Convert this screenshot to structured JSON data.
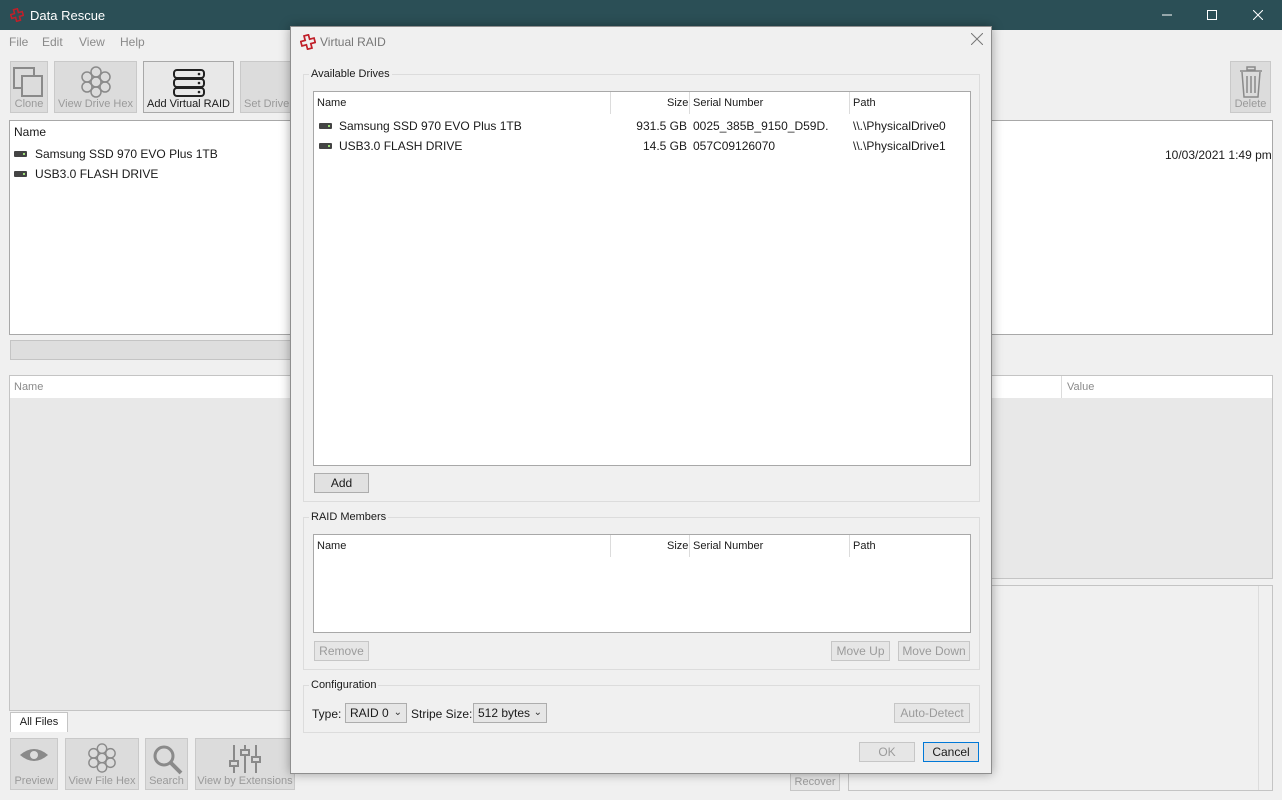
{
  "app": {
    "title": "Data Rescue"
  },
  "menu": {
    "file": "File",
    "edit": "Edit",
    "view": "View",
    "help": "Help"
  },
  "toolbar": {
    "clone": "Clone",
    "view_drive_hex": "View Drive Hex",
    "add_virtual_raid": "Add Virtual RAID",
    "set_drive": "Set Drive",
    "delete": "Delete"
  },
  "drives_panel": {
    "header": "Name",
    "items": [
      {
        "name": "Samsung SSD 970 EVO Plus 1TB"
      },
      {
        "name": "USB3.0 FLASH DRIVE"
      }
    ],
    "date": "10/03/2021 1:49 pm"
  },
  "files_panel": {
    "name_header": "Name",
    "value_header": "Value",
    "tab": "All Files"
  },
  "bottom_toolbar": {
    "preview": "Preview",
    "view_file_hex": "View File Hex",
    "search": "Search",
    "view_by_extensions": "View by Extensions",
    "recover": "Recover"
  },
  "dialog": {
    "title": "Virtual RAID",
    "available": {
      "label": "Available Drives",
      "columns": {
        "name": "Name",
        "size": "Size",
        "serial": "Serial Number",
        "path": "Path"
      },
      "rows": [
        {
          "name": "Samsung SSD 970 EVO Plus 1TB",
          "size": "931.5 GB",
          "serial": "0025_385B_9150_D59D.",
          "path": "\\\\.\\PhysicalDrive0"
        },
        {
          "name": "USB3.0 FLASH DRIVE",
          "size": "14.5 GB",
          "serial": "057C09126070",
          "path": "\\\\.\\PhysicalDrive1"
        }
      ],
      "add": "Add"
    },
    "members": {
      "label": "RAID Members",
      "columns": {
        "name": "Name",
        "size": "Size",
        "serial": "Serial Number",
        "path": "Path"
      },
      "remove": "Remove",
      "move_up": "Move Up",
      "move_down": "Move Down"
    },
    "config": {
      "label": "Configuration",
      "type_label": "Type:",
      "type_value": "RAID 0",
      "stripe_label": "Stripe Size:",
      "stripe_value": "512 bytes",
      "auto_detect": "Auto-Detect"
    },
    "ok": "OK",
    "cancel": "Cancel"
  },
  "colors": {
    "titlebar": "#2b4f56",
    "accent": "#c0202a"
  }
}
